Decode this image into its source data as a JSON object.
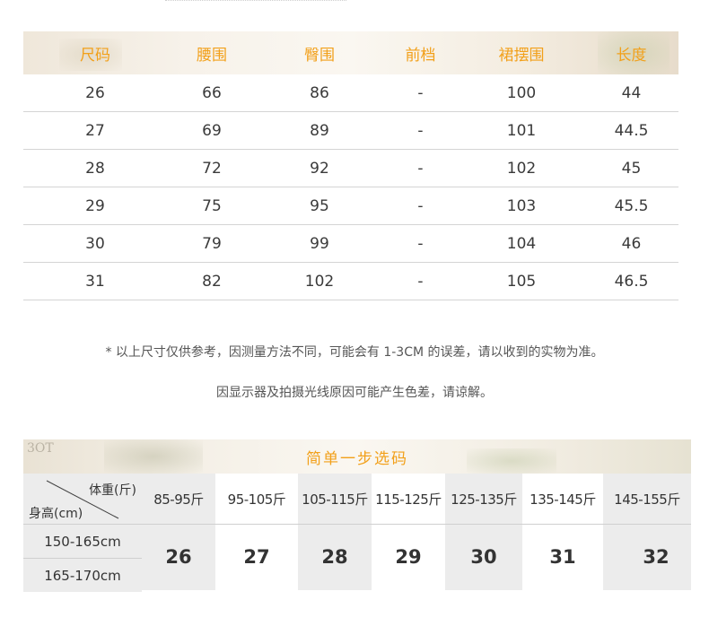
{
  "size_table": {
    "headers": [
      "尺码",
      "腰围",
      "臀围",
      "前档",
      "裙摆围",
      "长度"
    ],
    "rows": [
      [
        "26",
        "66",
        "86",
        "-",
        "100",
        "44"
      ],
      [
        "27",
        "69",
        "89",
        "-",
        "101",
        "44.5"
      ],
      [
        "28",
        "72",
        "92",
        "-",
        "102",
        "45"
      ],
      [
        "29",
        "75",
        "95",
        "-",
        "103",
        "45.5"
      ],
      [
        "30",
        "79",
        "99",
        "-",
        "104",
        "46"
      ],
      [
        "31",
        "82",
        "102",
        "-",
        "105",
        "46.5"
      ]
    ]
  },
  "notes": {
    "line1": "* 以上尺寸仅供参考，因测量方法不同，可能会有 1-3CM 的误差，请以收到的实物为准。",
    "line2": "因显示器及拍摄光线原因可能产生色差，请谅解。"
  },
  "select_table": {
    "title": "简单一步选码",
    "background_text": "3OT",
    "corner_weight_label": "体重(斤)",
    "corner_height_label": "身高(cm)",
    "weights": [
      "85-95斤",
      "95-105斤",
      "105-115斤",
      "115-125斤",
      "125-135斤",
      "135-145斤",
      "145-155斤"
    ],
    "heights": [
      "150-165cm",
      "165-170cm"
    ],
    "sizes": [
      "26",
      "27",
      "28",
      "29",
      "30",
      "31",
      "32"
    ]
  },
  "colors": {
    "accent": "#f2a01a",
    "text": "#333333",
    "row_border": "#d4d4d4",
    "shade": "#ececec"
  }
}
